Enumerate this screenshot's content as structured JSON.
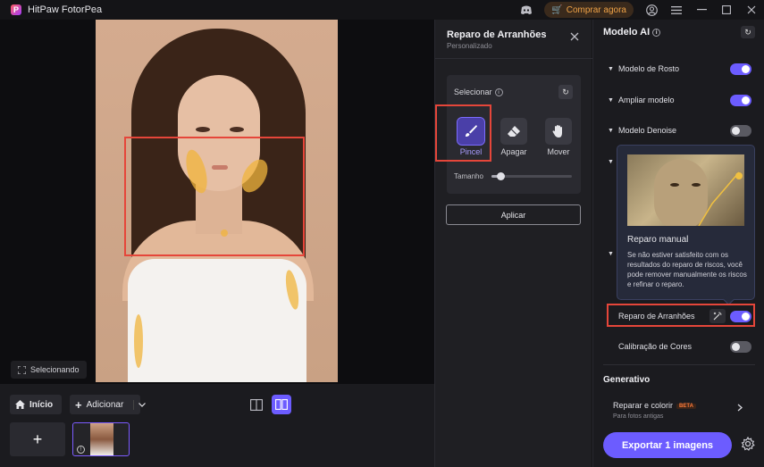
{
  "app": {
    "title": "HitPaw FotorPea",
    "buy_label": "Comprar agora",
    "colors": {
      "accent": "#6c5cff",
      "highlight": "#e5463a",
      "buy": "#f0a347"
    }
  },
  "canvas": {
    "status_label": "Selecionando"
  },
  "bottom": {
    "home_label": "Início",
    "add_label": "Adicionar",
    "add_tile": "+"
  },
  "tool_panel": {
    "title": "Reparo de Arranhões",
    "subtitle": "Personalizado",
    "select_label": "Selecionar",
    "tools": [
      {
        "label": "Pincel",
        "icon": "brush-icon",
        "active": true
      },
      {
        "label": "Apagar",
        "icon": "eraser-icon",
        "active": false
      },
      {
        "label": "Mover",
        "icon": "hand-icon",
        "active": false
      }
    ],
    "size_label": "Tamanho",
    "size_value": 0.12,
    "apply_label": "Aplicar"
  },
  "right_panel": {
    "title": "Modelo AI",
    "models": [
      {
        "label": "Modelo de Rosto",
        "on": true
      },
      {
        "label": "Ampliar modelo",
        "on": true
      },
      {
        "label": "Modelo Denoise",
        "on": false
      }
    ],
    "tooltip": {
      "title": "Reparo manual",
      "description": "Se não estiver satisfeito com os resultados do reparo de riscos, você pode remover manualmente os riscos e refinar o reparo."
    },
    "scratch_label": "Reparo de Arranhões",
    "scratch_on": true,
    "color_label": "Calibração de Cores",
    "color_on": false,
    "generative_title": "Generativo",
    "generative_item": "Reparar e colorir",
    "beta_badge": "BETA",
    "generative_sub": "Para fotos antigas",
    "export_label": "Exportar 1 imagens"
  }
}
